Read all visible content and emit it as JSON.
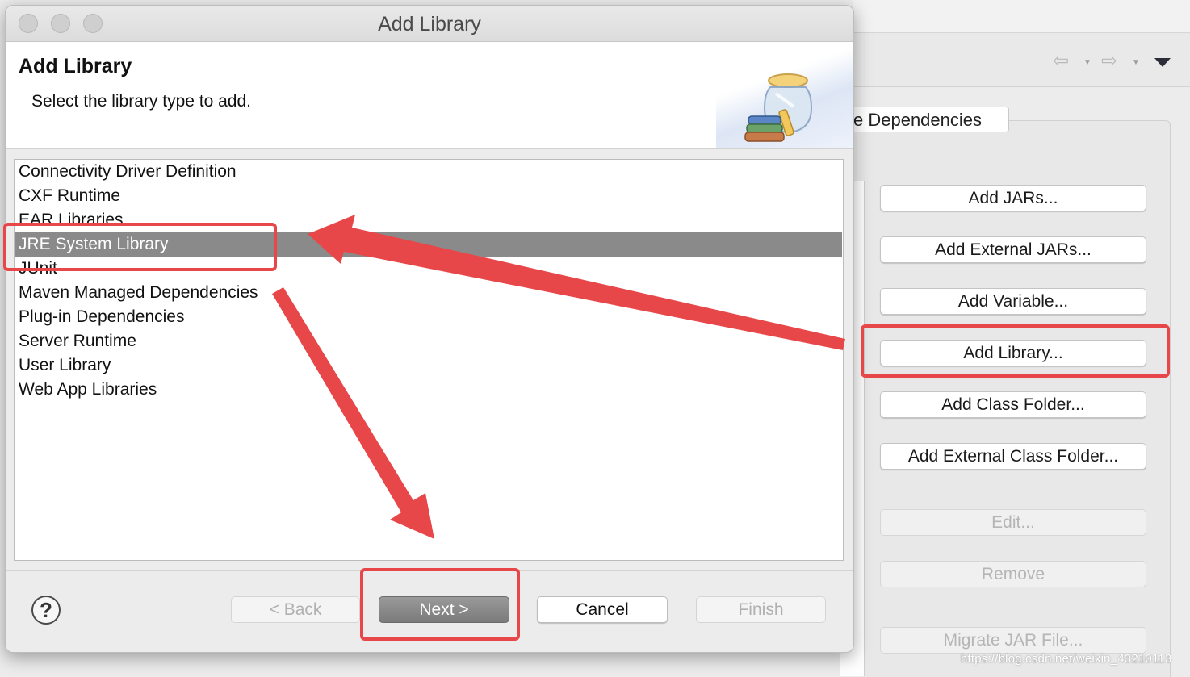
{
  "background_window": {
    "tab_label": "e Dependencies",
    "buttons": [
      {
        "label": "Add JARs...",
        "enabled": true
      },
      {
        "label": "Add External JARs...",
        "enabled": true
      },
      {
        "label": "Add Variable...",
        "enabled": true
      },
      {
        "label": "Add Library...",
        "enabled": true
      },
      {
        "label": "Add Class Folder...",
        "enabled": true
      },
      {
        "label": "Add External Class Folder...",
        "enabled": true
      },
      {
        "label": "Edit...",
        "enabled": false
      },
      {
        "label": "Remove",
        "enabled": false
      },
      {
        "label": "Migrate JAR File...",
        "enabled": false
      }
    ],
    "toolbar_icons": [
      "back-arrow-icon",
      "forward-arrow-icon",
      "view-menu-icon"
    ]
  },
  "dialog": {
    "window_title": "Add Library",
    "header": {
      "title": "Add Library",
      "description": "Select the library type to add."
    },
    "library_types": [
      {
        "label": "Connectivity Driver Definition",
        "selected": false
      },
      {
        "label": "CXF Runtime",
        "selected": false
      },
      {
        "label": "EAR Libraries",
        "selected": false
      },
      {
        "label": "JRE System Library",
        "selected": true
      },
      {
        "label": "JUnit",
        "selected": false
      },
      {
        "label": "Maven Managed Dependencies",
        "selected": false
      },
      {
        "label": "Plug-in Dependencies",
        "selected": false
      },
      {
        "label": "Server Runtime",
        "selected": false
      },
      {
        "label": "User Library",
        "selected": false
      },
      {
        "label": "Web App Libraries",
        "selected": false
      }
    ],
    "buttons": {
      "help": "?",
      "back": "< Back",
      "next": "Next >",
      "cancel": "Cancel",
      "finish": "Finish"
    }
  },
  "watermark": "https://blog.csdn.net/weixin_43210113",
  "colors": {
    "annotation": "#e8474a",
    "selection": "#8a8a8a",
    "default_button": "#7b7b7b"
  }
}
